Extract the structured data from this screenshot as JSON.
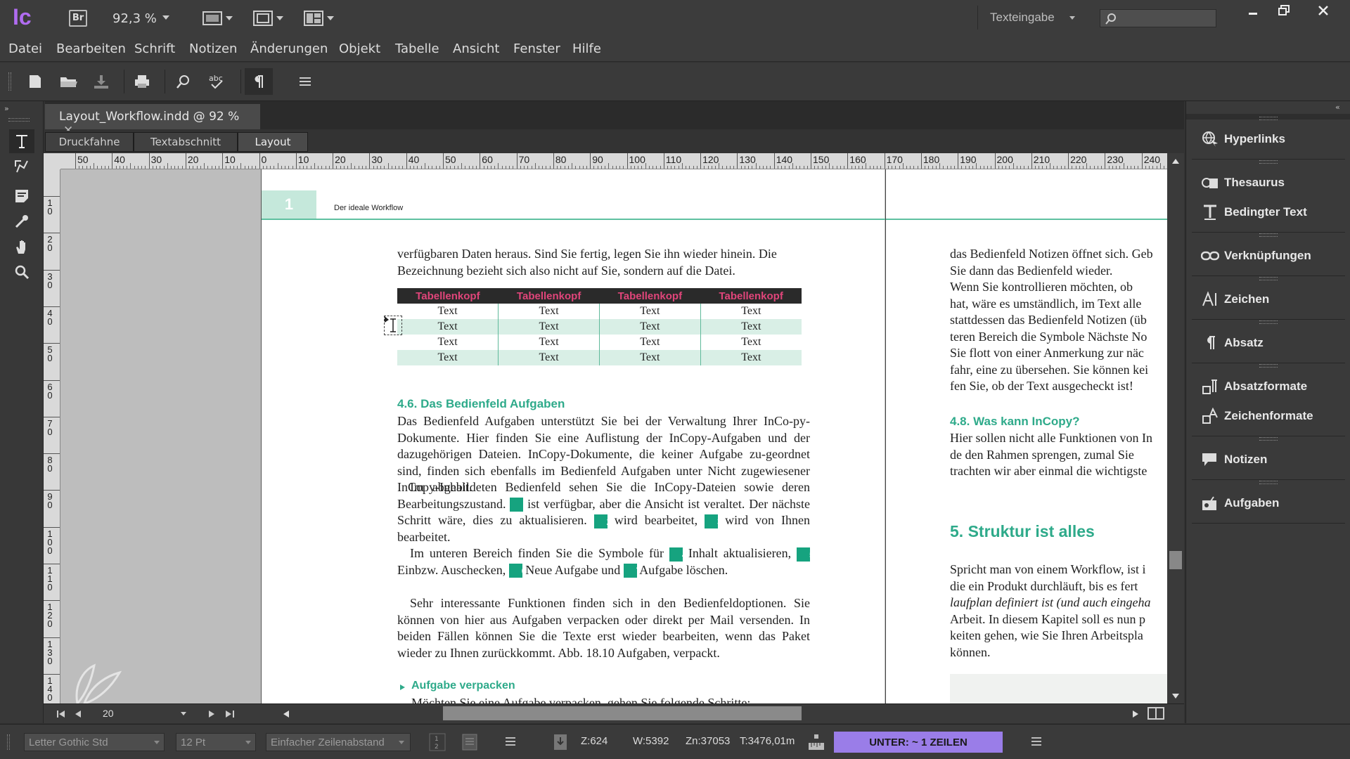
{
  "app": {
    "logo": "Ic",
    "bridge_label": "Br",
    "zoom": "92,3 %",
    "workspace": "Texteingabe",
    "search_placeholder": ""
  },
  "menu": [
    "Datei",
    "Bearbeiten",
    "Schrift",
    "Notizen",
    "Änderungen",
    "Objekt",
    "Tabelle",
    "Ansicht",
    "Fenster",
    "Hilfe"
  ],
  "document": {
    "tab_title": "Layout_Workflow.indd @ 92 %",
    "view_tabs": [
      "Druckfahne",
      "Textabschnitt",
      "Layout"
    ]
  },
  "ruler": {
    "h_labels": [
      "50",
      "40",
      "30",
      "20",
      "10",
      "0",
      "10",
      "20",
      "30",
      "40",
      "50",
      "60",
      "70",
      "80",
      "90",
      "100",
      "110",
      "120",
      "130",
      "140",
      "150",
      "160",
      "170",
      "180",
      "190",
      "200",
      "210",
      "220",
      "230",
      "240"
    ],
    "v_labels": [
      "10",
      "20",
      "30",
      "40",
      "50",
      "60",
      "70",
      "80",
      "90",
      "100",
      "110",
      "120",
      "130",
      "140"
    ]
  },
  "page": {
    "number": "1",
    "header_title": "Der ideale Workflow",
    "intro_line1": "verfügbaren Daten heraus. Sind Sie fertig, legen Sie ihn wieder hinein. Die",
    "intro_line2": "Bezeichnung bezieht sich also nicht auf Sie, sondern auf die Datei.",
    "table": {
      "headers": [
        "Tabellenkopf",
        "Tabellenkopf",
        "Tabellenkopf",
        "Tabellenkopf"
      ],
      "rows": [
        [
          "Text",
          "Text",
          "Text",
          "Text"
        ],
        [
          "Text",
          "Text",
          "Text",
          "Text"
        ],
        [
          "Text",
          "Text",
          "Text",
          "Text"
        ],
        [
          "Text",
          "Text",
          "Text",
          "Text"
        ]
      ]
    },
    "section_heading": "4.6.  Das Bedienfeld Aufgaben",
    "p1": "Das Bedienfeld Aufgaben unterstützt Sie bei der Verwaltung Ihrer InCo-py-Dokumente. Hier finden Sie eine Auflistung der InCopy-Aufgaben und der dazugehörigen Dateien. InCopy-Dokumente, die keiner Aufgabe zu-geordnet sind, finden sich ebenfalls im Bedienfeld Aufgaben unter Nicht zugewiesener InCopy-Inhalt.",
    "p2_a": "Im abgebildeten Bedienfeld sehen Sie die InCopy-Dateien sowie deren Bearbeitungszustand.",
    "p2_b": "ist verfügbar, aber die Ansicht ist veraltet. Der nächste Schritt wäre, dies zu aktualisieren.",
    "p2_c": "wird bearbeitet,",
    "p2_d": "wird von Ihnen bearbeitet.",
    "p3_a": "Im unteren Bereich finden Sie die Symbole für",
    "p3_b": "Inhalt aktualisieren,",
    "p3_c": "Einbzw. Auschecken,",
    "p3_d": "Neue Aufgabe und",
    "p3_e": "Aufgabe löschen.",
    "p4": "Sehr interessante Funktionen finden sich in den Bedienfeldoptionen. Sie können von hier aus Aufgaben verpacken oder direkt per Mail versenden. In beiden Fällen können Sie die Texte erst wieder bearbeiten, wenn das Paket wieder zu Ihnen zurückkommt. Abb. 18.10 Aufgaben, verpackt.",
    "subheading": "Aufgabe verpacken",
    "cut_line": "Möchten Sie eine Aufgabe verpacken, gehen Sie folgende Schritte:",
    "markers": [
      "1",
      "2",
      "3",
      "4",
      "5",
      "6",
      "7"
    ]
  },
  "page2": {
    "lines_a": [
      "das Bedienfeld Notizen öffnet sich. Geb",
      "Sie dann das Bedienfeld wieder.",
      "   Wenn Sie kontrollieren möchten, ob",
      "hat, wäre es umständlich, im Text alle",
      "stattdessen das Bedienfeld Notizen (üb",
      "teren Bereich die Symbole Nächste No",
      "Sie flott von einer Anmerkung zur näc",
      "fahr, eine zu übersehen. Sie können kei",
      "fen Sie, ob der Text ausgecheckt ist!"
    ],
    "heading_48": "4.8.  Was kann InCopy?",
    "lines_b": [
      "Hier sollen nicht alle Funktionen von In",
      "de den Rahmen sprengen, zumal Sie",
      "trachten wir aber einmal die wichtigste"
    ],
    "chapter_heading": "5.  Struktur ist alles",
    "lines_c": [
      "Spricht man von einem Workflow, ist i",
      "die ein Produkt durchläuft, bis es fert",
      "laufplan definiert ist (und auch eingeha",
      "Arbeit. In diesem Kapitel soll es nun p",
      "keiten gehen, wie Sie Ihren Arbeitspla",
      "können."
    ]
  },
  "panels": [
    "Hyperlinks",
    "Thesaurus",
    "Bedingter Text",
    "Verknüpfungen",
    "Zeichen",
    "Absatz",
    "Absatzformate",
    "Zeichenformate",
    "Notizen",
    "Aufgaben"
  ],
  "statusbar": {
    "font": "Letter Gothic Std",
    "size": "12 Pt",
    "spacing": "Einfacher Zeilenabstand",
    "z": "Z:624",
    "w": "W:5392",
    "zn": "Zn:37053",
    "t": "T:3476,01m",
    "overset": "UNTER:  ~ 1 ZEILEN",
    "page_field": "20"
  },
  "colors": {
    "accent": "#2eaa8a",
    "table_header_text": "#e0457a",
    "overset_bg": "#9a7de8",
    "logo": "#b06cf0"
  }
}
